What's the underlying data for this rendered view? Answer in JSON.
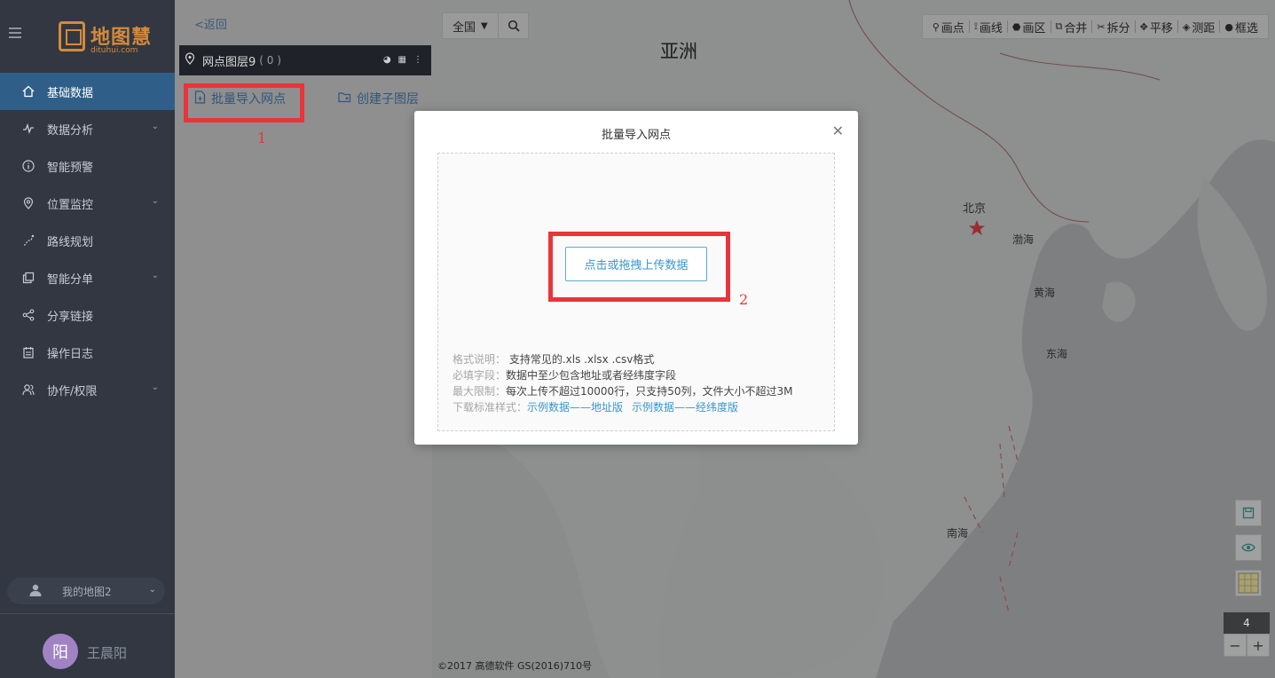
{
  "sidebar": {
    "logo_text": "地图慧",
    "logo_sub": "dituhui.com",
    "items": [
      {
        "label": "基础数据"
      },
      {
        "label": "数据分析"
      },
      {
        "label": "智能预警"
      },
      {
        "label": "位置监控"
      },
      {
        "label": "路线规划"
      },
      {
        "label": "智能分单"
      },
      {
        "label": "分享链接"
      },
      {
        "label": "操作日志"
      },
      {
        "label": "协作/权限"
      }
    ],
    "my_maps": "我的地图2",
    "user": {
      "avatar": "阳",
      "name": "王晨阳"
    }
  },
  "panel": {
    "back": "<返回",
    "layer_name": "网点图层9",
    "layer_count": "( 0 )",
    "import_label": "批量导入网点",
    "create_label": "创建子图层",
    "annotation_1": "1"
  },
  "map": {
    "region": "全国",
    "tools": [
      "画点",
      "画线",
      "画区",
      "合并",
      "拆分",
      "平移",
      "测距",
      "框选"
    ],
    "labels": {
      "asia": "亚洲",
      "beijing": "北京",
      "bohai": "渤海",
      "yellow_sea": "黄海",
      "east_sea": "东海",
      "south_sea": "南海"
    },
    "zoom_level": "4",
    "zoom_out": "−",
    "zoom_in": "+",
    "copyright": "©2017 高德软件 GS(2016)710号"
  },
  "modal": {
    "title": "批量导入网点",
    "upload_label": "点击或拖拽上传数据",
    "annotation_2": "2",
    "notes": [
      {
        "key": "格式说明：",
        "value": " 支持常见的.xls .xlsx .csv格式"
      },
      {
        "key": "必填字段：",
        "value": "数据中至少包含地址或者经纬度字段"
      },
      {
        "key": "最大限制：",
        "value": "每次上传不超过10000行，只支持50列，文件大小不超过3M"
      }
    ],
    "download_key": "下载标准样式：",
    "download_links": [
      "示例数据——地址版",
      "示例数据——经纬度版"
    ]
  }
}
